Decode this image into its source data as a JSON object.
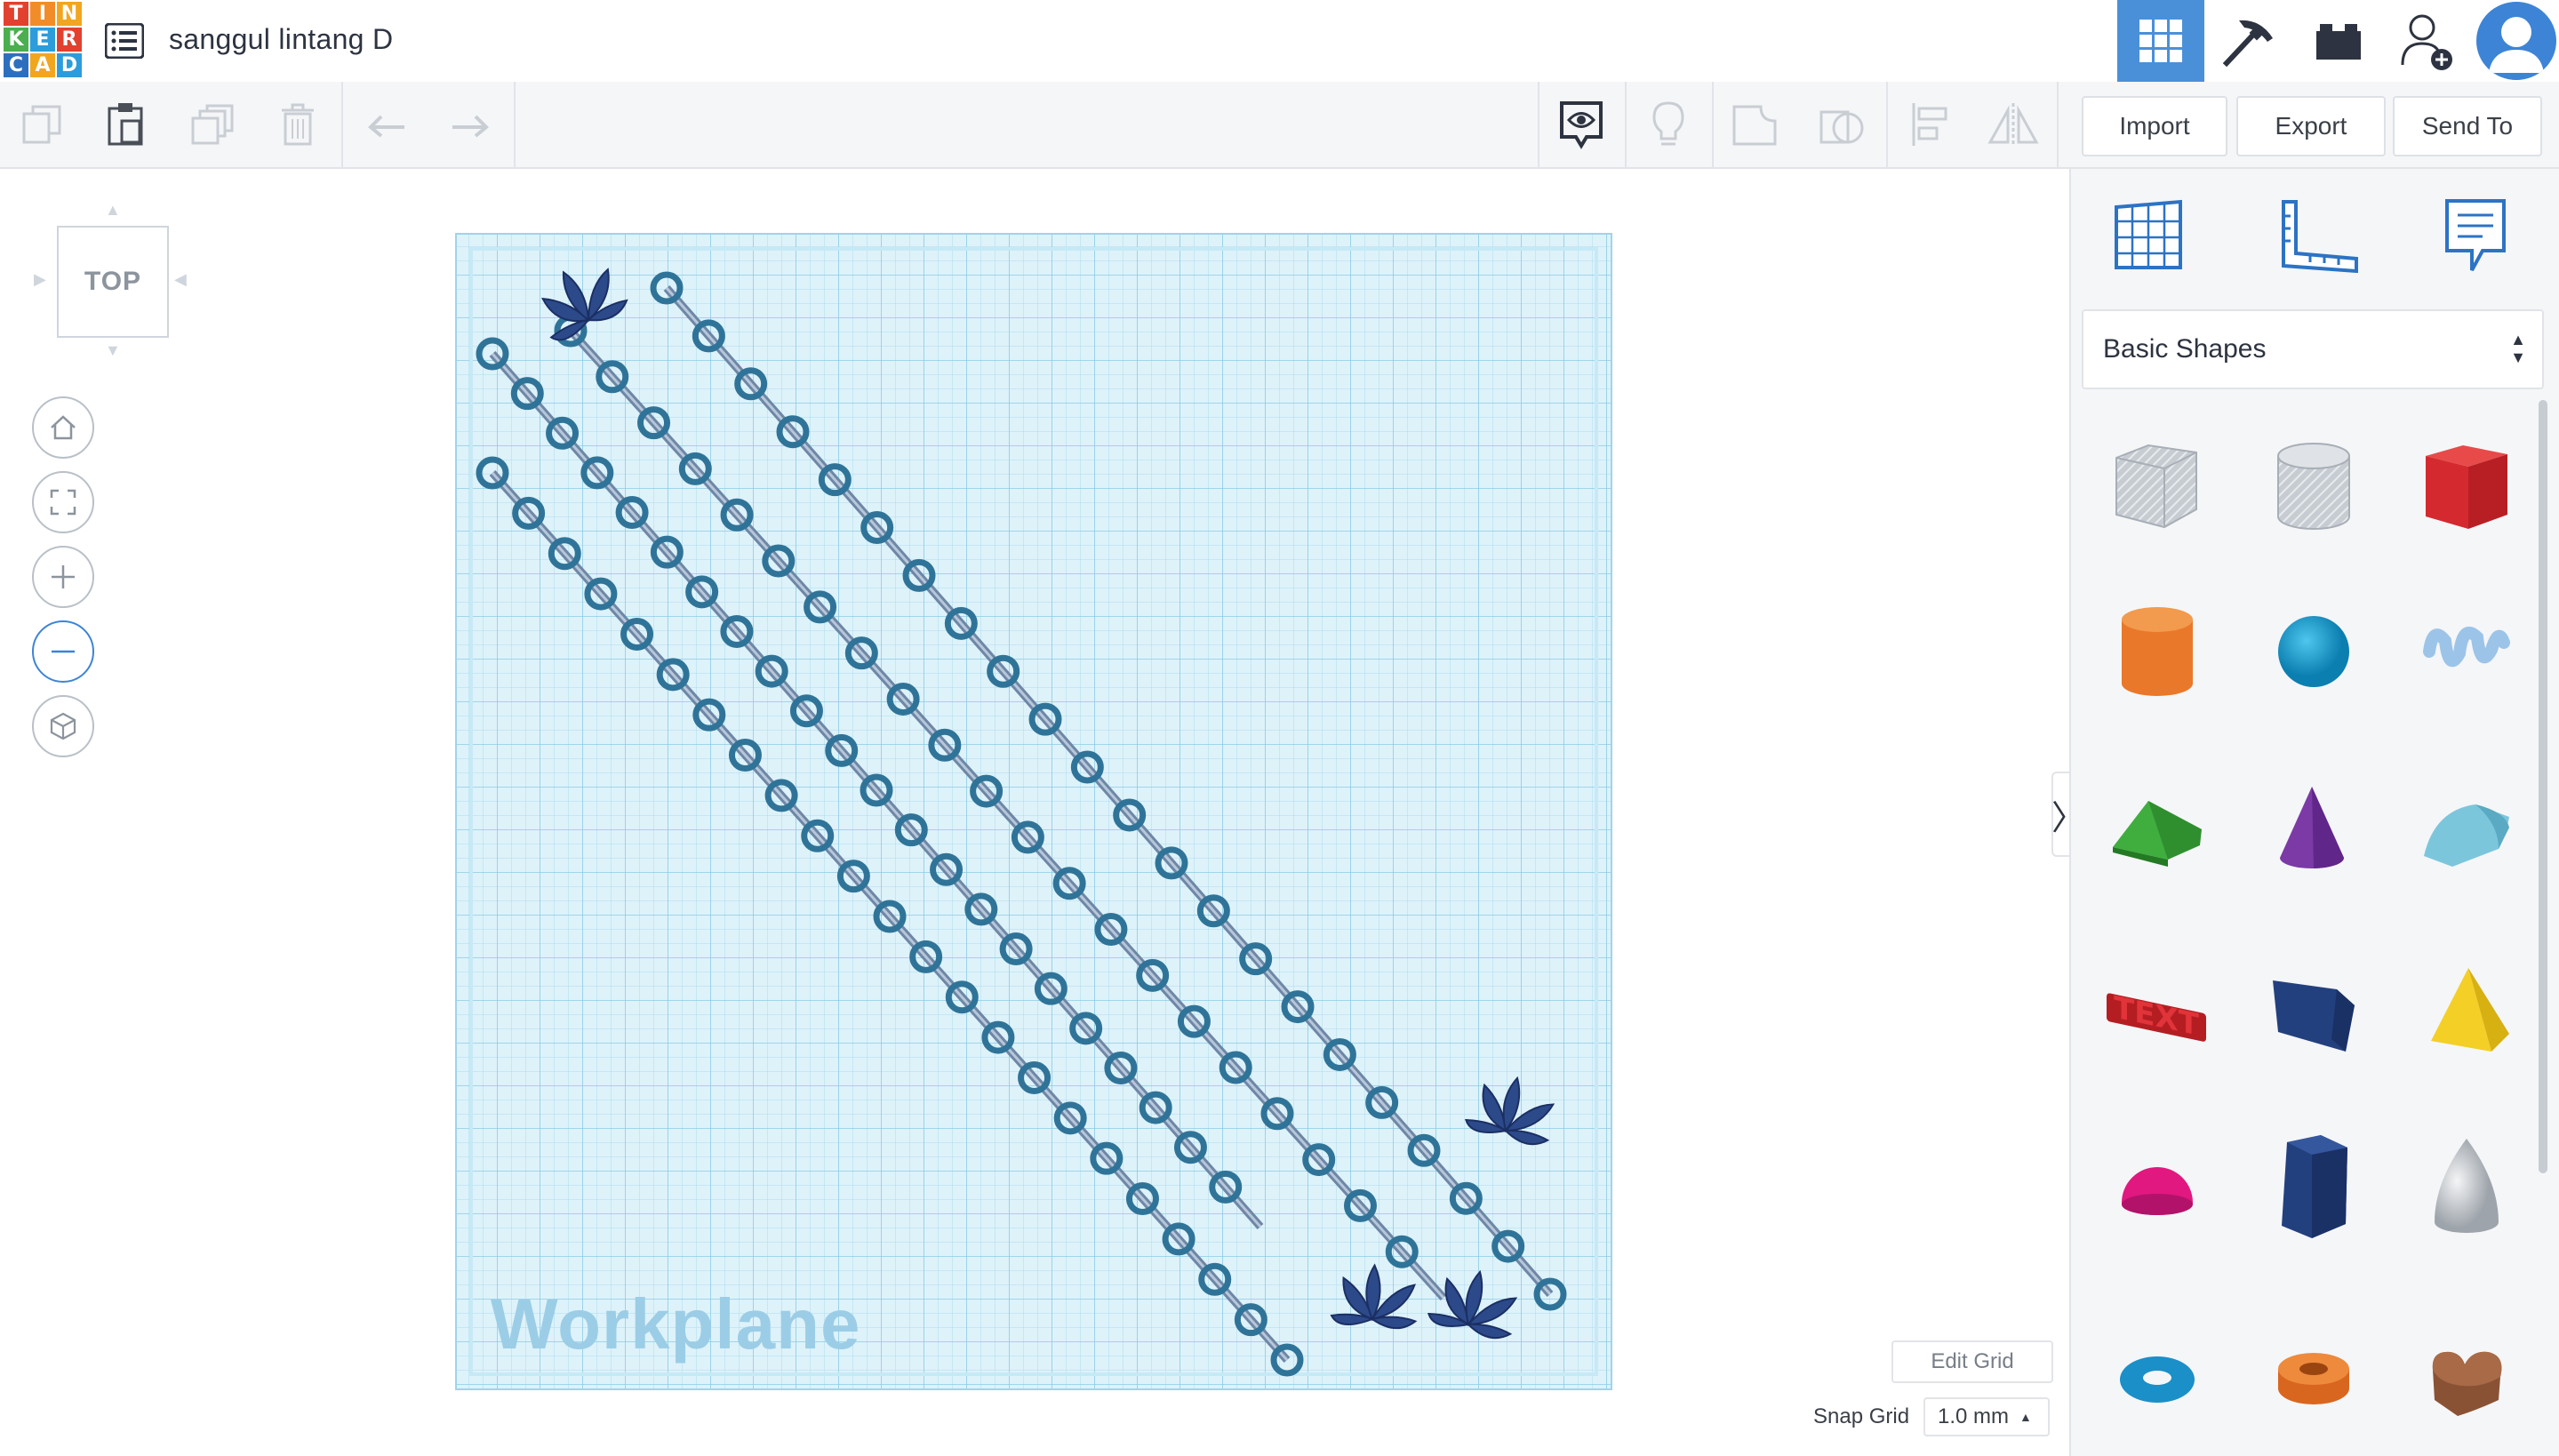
{
  "app": {
    "logo_letters": [
      "T",
      "I",
      "N",
      "K",
      "E",
      "R",
      "C",
      "A",
      "D"
    ],
    "logo_colors": [
      "#e2412f",
      "#f28c28",
      "#f2a61f",
      "#4bae4f",
      "#2d9cdb",
      "#e2412f",
      "#2d6fbf",
      "#f2a61f",
      "#2d9cdb"
    ],
    "design_title": "sanggul lintang D",
    "accent_color": "#4a90d9"
  },
  "topnav": {
    "items": [
      {
        "name": "3d-design-grid-icon",
        "active": true
      },
      {
        "name": "pickaxe-icon",
        "active": false
      },
      {
        "name": "lego-brick-icon",
        "active": false
      },
      {
        "name": "add-user-icon",
        "active": false
      },
      {
        "name": "avatar-icon",
        "active": false
      }
    ]
  },
  "toolbar": {
    "left_tools": [
      "copy-icon",
      "paste-icon",
      "duplicate-icon",
      "delete-icon",
      "undo-icon",
      "redo-icon"
    ],
    "right_tools": [
      "show-all-icon",
      "light-bulb-icon",
      "group-icon",
      "ungroup-icon",
      "align-icon",
      "mirror-icon"
    ],
    "import_label": "Import",
    "export_label": "Export",
    "send_to_label": "Send To"
  },
  "viewport": {
    "viewcube_label": "TOP",
    "nav_buttons": [
      "home-view-icon",
      "fit-view-icon",
      "zoom-in-icon",
      "zoom-out-icon",
      "projection-cube-icon"
    ],
    "workplane_label": "Workplane",
    "edit_grid_label": "Edit Grid",
    "snap_grid_label": "Snap Grid",
    "snap_grid_value": "1.0 mm",
    "collapse_arrow": "〉"
  },
  "right_panel": {
    "view_icons": [
      "workplane-grid-icon",
      "ruler-icon",
      "notes-icon"
    ],
    "shape_category": "Basic Shapes",
    "shapes": [
      "box-hole",
      "cylinder-hole",
      "box",
      "cylinder",
      "sphere",
      "scribble",
      "roof",
      "cone",
      "round-roof",
      "text",
      "wedge",
      "pyramid",
      "half-sphere",
      "polygon",
      "paraboloid",
      "torus",
      "tube",
      "heart"
    ]
  }
}
